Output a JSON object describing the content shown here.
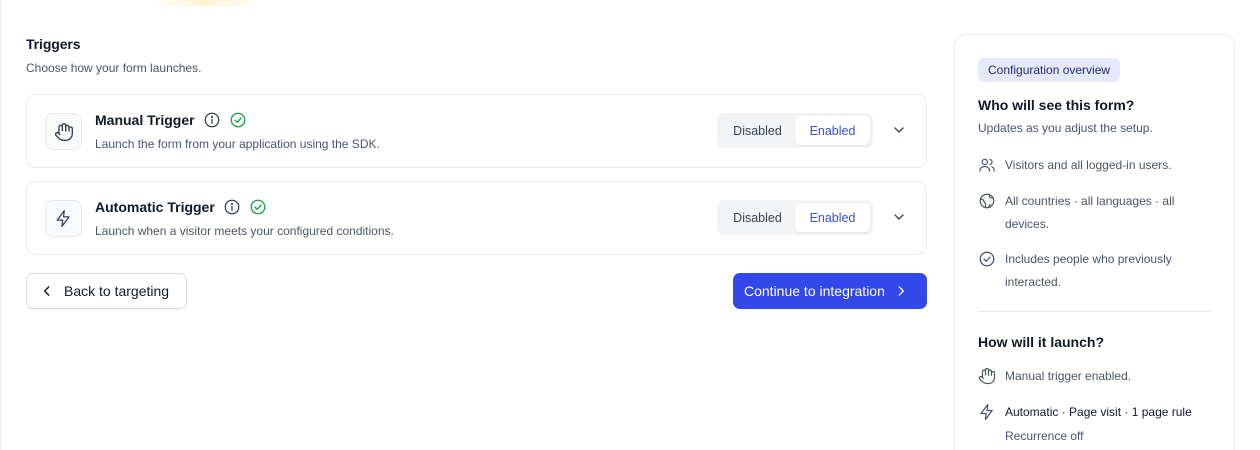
{
  "triggers": {
    "title": "Triggers",
    "subtitle": "Choose how your form launches.",
    "manual": {
      "title": "Manual Trigger",
      "description": "Launch the form from your application using the SDK.",
      "disabled_label": "Disabled",
      "enabled_label": "Enabled",
      "state": "Enabled"
    },
    "automatic": {
      "title": "Automatic Trigger",
      "description": "Launch when a visitor meets your configured conditions.",
      "disabled_label": "Disabled",
      "enabled_label": "Enabled",
      "state": "Enabled"
    }
  },
  "actions": {
    "back_label": "Back to targeting",
    "continue_label": "Continue to integration"
  },
  "overview": {
    "badge": "Configuration overview",
    "audience_heading": "Who will see this form?",
    "audience_sub": "Updates as you adjust the setup.",
    "audience_items": [
      "Visitors and all logged-in users.",
      "All countries · all languages · all devices.",
      "Includes people who previously interacted."
    ],
    "launch_heading": "How will it launch?",
    "launch_items": [
      "Manual trigger enabled.",
      "Automatic · Page visit · 1 page rule",
      "Recurrence off"
    ]
  },
  "colors": {
    "primary": "#3348ea",
    "enabled_text": "#3b4fd8",
    "success": "#16a34a",
    "badge_bg": "#e6e9fb"
  }
}
